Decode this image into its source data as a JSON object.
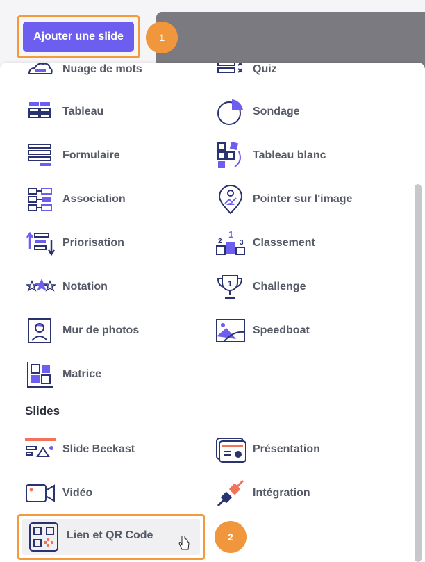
{
  "toolbar": {
    "add_slide_label": "Ajouter une slide"
  },
  "badges": {
    "first": "1",
    "second": "2"
  },
  "interactions_left": [
    {
      "label": "Nuage de mots",
      "icon": "word-cloud-icon"
    },
    {
      "label": "Tableau",
      "icon": "table-icon"
    },
    {
      "label": "Formulaire",
      "icon": "form-icon"
    },
    {
      "label": "Association",
      "icon": "association-icon"
    },
    {
      "label": "Priorisation",
      "icon": "prioritization-icon"
    },
    {
      "label": "Notation",
      "icon": "rating-stars-icon"
    },
    {
      "label": "Mur de photos",
      "icon": "photo-wall-icon"
    },
    {
      "label": "Matrice",
      "icon": "matrix-icon"
    }
  ],
  "interactions_right": [
    {
      "label": "Quiz",
      "icon": "quiz-icon"
    },
    {
      "label": "Sondage",
      "icon": "poll-pie-icon"
    },
    {
      "label": "Tableau blanc",
      "icon": "whiteboard-icon"
    },
    {
      "label": "Pointer sur l'image",
      "icon": "pin-on-image-icon"
    },
    {
      "label": "Classement",
      "icon": "ranking-podium-icon"
    },
    {
      "label": "Challenge",
      "icon": "trophy-icon"
    },
    {
      "label": "Speedboat",
      "icon": "speedboat-icon"
    }
  ],
  "slides_section": {
    "title": "Slides"
  },
  "slides_left": [
    {
      "label": "Slide Beekast",
      "icon": "slide-beekast-icon"
    },
    {
      "label": "Vidéo",
      "icon": "video-icon"
    },
    {
      "label": "Lien et QR Code",
      "icon": "qr-code-icon"
    }
  ],
  "slides_right": [
    {
      "label": "Présentation",
      "icon": "presentation-icon"
    },
    {
      "label": "Intégration",
      "icon": "integration-plug-icon"
    }
  ],
  "colors": {
    "accent": "#6d5ef0",
    "highlight": "#f59a3c",
    "navy": "#2b3270",
    "coral": "#f2735a"
  }
}
